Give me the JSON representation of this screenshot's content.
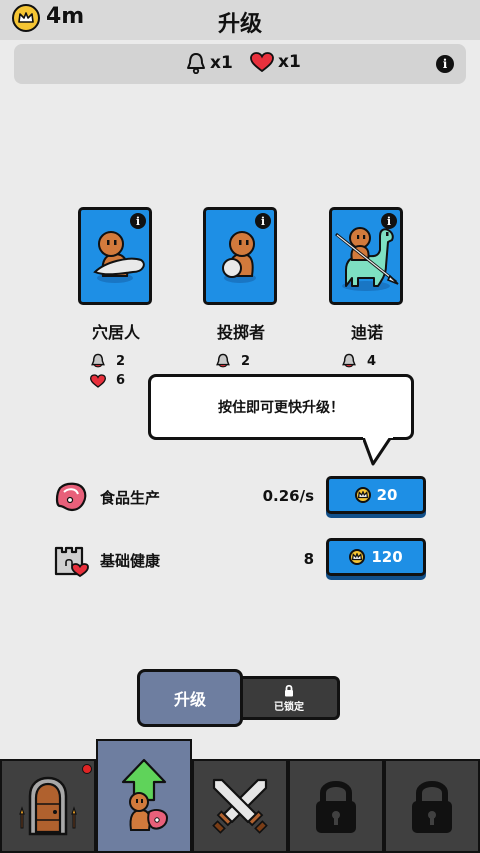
{
  "header": {
    "coins": "4m",
    "title": "升级"
  },
  "status": {
    "attack_multiplier": "x1",
    "health_multiplier": "x1",
    "info_icon": "info-icon"
  },
  "units": [
    {
      "name": "穴居人",
      "attack": "2",
      "health": "6"
    },
    {
      "name": "投掷者",
      "attack": "2",
      "health": ""
    },
    {
      "name": "迪诺",
      "attack": "4",
      "health": ""
    }
  ],
  "tooltip": {
    "text": "按住即可更快升级！"
  },
  "upgrades": [
    {
      "label": "食品生产",
      "value": "0.26/s",
      "cost": "20",
      "icon": "meat-icon"
    },
    {
      "label": "基础健康",
      "value": "8",
      "cost": "120",
      "icon": "castle-heart-icon"
    }
  ],
  "tabs": {
    "upgrade": "升级",
    "locked": "已锁定"
  },
  "nav": [
    {
      "icon": "door-icon",
      "badge": true
    },
    {
      "icon": "upgrade-arrow-icon"
    },
    {
      "icon": "crossed-swords-icon"
    },
    {
      "icon": "lock-icon"
    },
    {
      "icon": "lock-icon"
    }
  ],
  "colors": {
    "accent_blue": "#1e8fe5",
    "active_tab": "#6e7ea0",
    "nav_bg": "#404040",
    "coin_yellow": "#f5c534",
    "heart_red": "#e8303c"
  }
}
